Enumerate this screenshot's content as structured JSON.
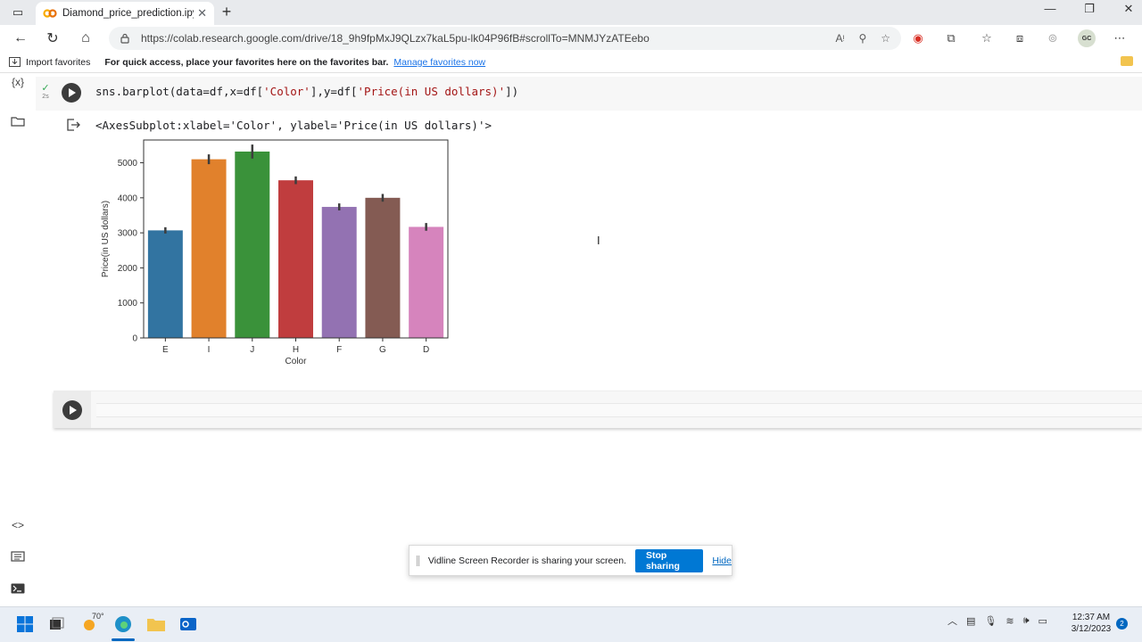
{
  "browser": {
    "tab_title": "Diamond_price_prediction.ipynb",
    "url": "https://colab.research.google.com/drive/18_9h9fpMxJ9QLzx7kaL5pu-lk04P96fB#scrollTo=MNMJYzATEebo",
    "profile_initials": "GC"
  },
  "favorites_bar": {
    "import_label": "Import favorites",
    "hint_text": "For quick access, place your favorites here on the favorites bar.",
    "manage_link": "Manage favorites now"
  },
  "notebook": {
    "cell1": {
      "run_time": "2s",
      "code_prefix": "sns.barplot(data=df,x=df[",
      "code_str1": "'Color'",
      "code_mid": "],y=df[",
      "code_str2": "'Price(in US dollars)'",
      "code_suffix": "])",
      "output_text": "<AxesSubplot:xlabel='Color', ylabel='Price(in US dollars)'>"
    }
  },
  "chart_data": {
    "type": "bar",
    "categories": [
      "E",
      "I",
      "J",
      "H",
      "F",
      "G",
      "D"
    ],
    "values": [
      3070,
      5100,
      5320,
      4500,
      3740,
      4000,
      3170
    ],
    "error_bars": [
      [
        2980,
        3160
      ],
      [
        4960,
        5240
      ],
      [
        5120,
        5520
      ],
      [
        4390,
        4610
      ],
      [
        3640,
        3840
      ],
      [
        3890,
        4110
      ],
      [
        3060,
        3280
      ]
    ],
    "colors": [
      "#3274a1",
      "#e1812c",
      "#3a923a",
      "#c03d3e",
      "#9372b2",
      "#845b53",
      "#d684bd"
    ],
    "xlabel": "Color",
    "ylabel": "Price(in US dollars)",
    "ylim": [
      0,
      5650
    ],
    "yticks": [
      0,
      1000,
      2000,
      3000,
      4000,
      5000
    ],
    "ytick_labels": [
      "0",
      "1000",
      "2000",
      "3000",
      "4000",
      "5000"
    ],
    "grid": false
  },
  "share_banner": {
    "message": "Vidline Screen Recorder is sharing your screen.",
    "stop_label": "Stop sharing",
    "hide_label": "Hide"
  },
  "taskbar": {
    "weather_temp": "70°",
    "time": "12:37 AM",
    "date": "3/12/2023",
    "notification_count": "2"
  }
}
